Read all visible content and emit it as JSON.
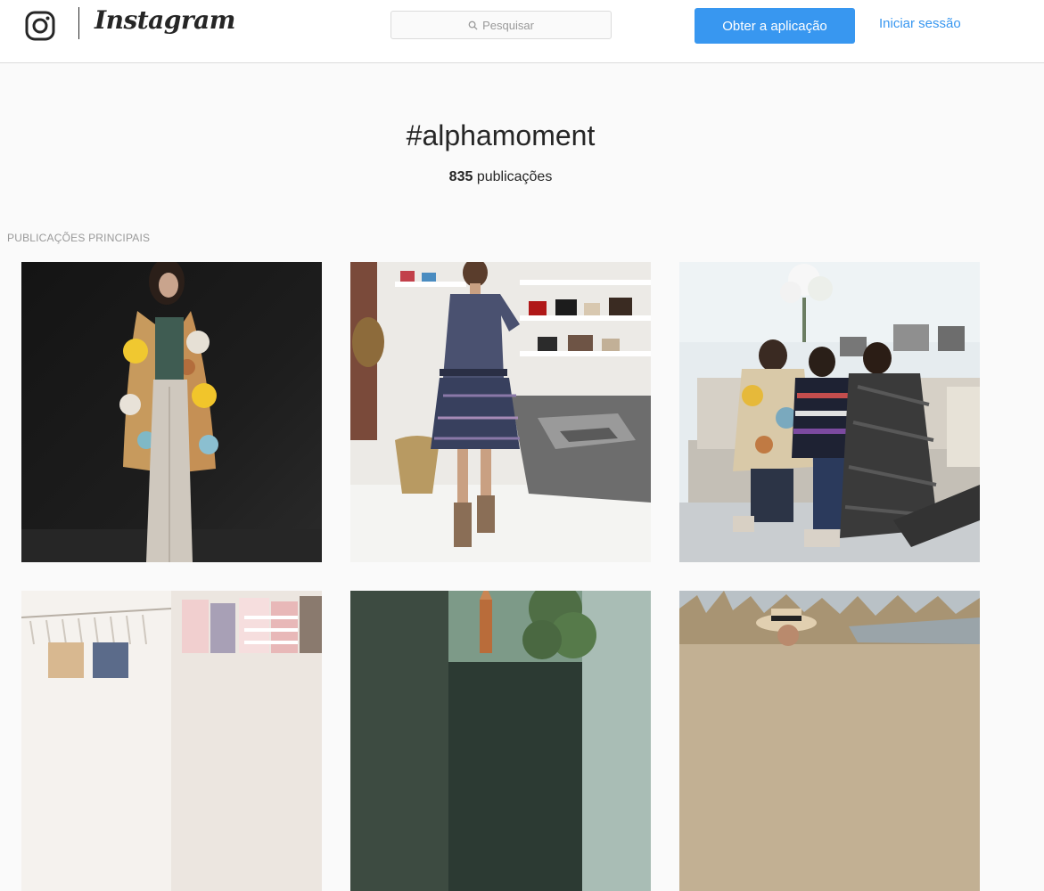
{
  "header": {
    "logo_name": "Instagram",
    "search_placeholder": "Pesquisar",
    "get_app_label": "Obter a aplicação",
    "login_label": "Iniciar sessão"
  },
  "tag": {
    "name": "#alphamoment",
    "count": "835",
    "count_suffix": " publicações"
  },
  "section": {
    "label": "PUBLICAÇÕES PRINCIPAIS"
  },
  "colors": {
    "accent": "#3897f0",
    "background": "#fafafa"
  }
}
